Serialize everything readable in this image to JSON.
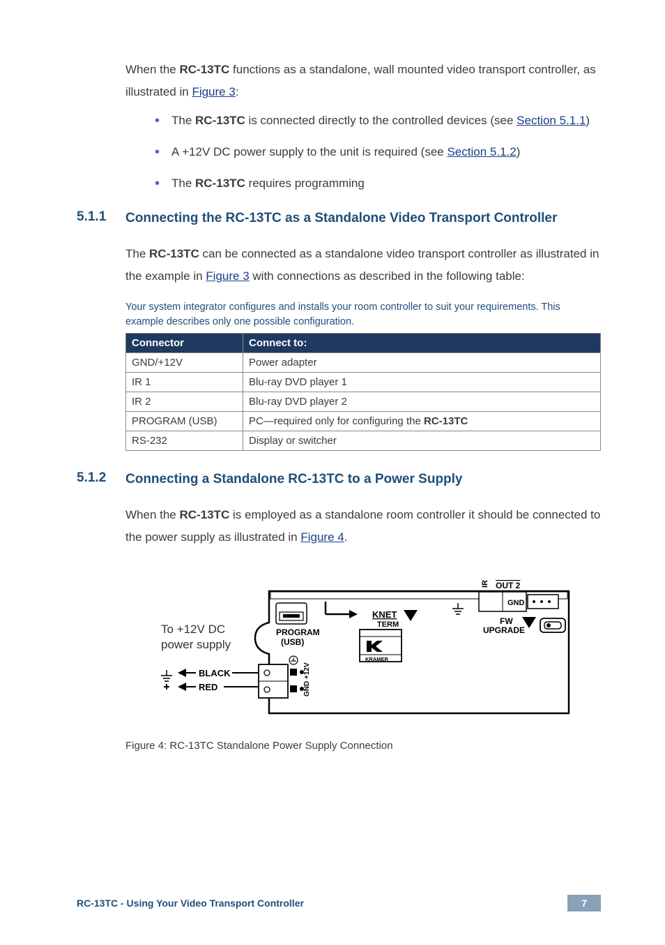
{
  "intro": {
    "pre": "When the ",
    "device": "RC-13TC",
    "mid": " functions as a standalone, wall mounted video transport controller, as illustrated in ",
    "figlink": "Figure 3",
    "post": ":"
  },
  "bullets": [
    {
      "pre": "The ",
      "bold": "RC-13TC",
      "mid": " is connected directly to the controlled devices (see ",
      "link": "Section 5.1.1",
      "post": ")"
    },
    {
      "pre": "A +12V DC power supply to the unit is required (see ",
      "bold": "",
      "mid": "",
      "link": "Section 5.1.2",
      "post": ")"
    },
    {
      "pre": "The ",
      "bold": "RC-13TC",
      "mid": " requires programming",
      "link": "",
      "post": ""
    }
  ],
  "sec511": {
    "num": "5.1.1",
    "title": "Connecting the RC-13TC as a Standalone Video Transport Controller",
    "para_pre": "The ",
    "para_bold": "RC-13TC",
    "para_mid": " can be connected as a standalone video transport controller as illustrated in the example in ",
    "para_link": "Figure 3",
    "para_post": " with connections as described in the following table:",
    "note": "Your system integrator configures and installs your room controller to suit your requirements. This example describes only one possible configuration.",
    "table": {
      "h1": "Connector",
      "h2": "Connect to:",
      "rows": [
        {
          "c1": "GND/+12V",
          "c2": "Power adapter"
        },
        {
          "c1": "IR 1",
          "c2": "Blu-ray DVD player 1"
        },
        {
          "c1": "IR 2",
          "c2": "Blu-ray DVD player 2"
        },
        {
          "c1": "PROGRAM (USB)",
          "c2_pre": "PC—required only for configuring the ",
          "c2_bold": "RC-13TC"
        },
        {
          "c1": "RS-232",
          "c2": "Display or switcher"
        }
      ]
    }
  },
  "sec512": {
    "num": "5.1.2",
    "title": "Connecting a Standalone RC-13TC to a Power Supply",
    "para_pre": "When the ",
    "para_bold": "RC-13TC",
    "para_mid": " is employed as a standalone room controller it should be connected to the power supply as illustrated in ",
    "para_link": "Figure 4",
    "para_post": "."
  },
  "figure": {
    "caption": "Figure 4: RC-13TC Standalone Power Supply Connection",
    "labels": {
      "to_psu_line1": "To +12V DC",
      "to_psu_line2": "power supply",
      "black": "BLACK",
      "red": "RED",
      "program1": "PROGRAM",
      "program2": "(USB)",
      "knet1": "KNET",
      "knet2": "TERM",
      "ir": "IR",
      "out2": "OUT 2",
      "gnd": "GND",
      "fw": "FW",
      "upgrade": "UPGRADE",
      "kramer": "KRAMER",
      "gnd12v": "GND +12V"
    }
  },
  "footer": {
    "left": "RC-13TC - Using Your Video Transport Controller",
    "page": "7"
  }
}
